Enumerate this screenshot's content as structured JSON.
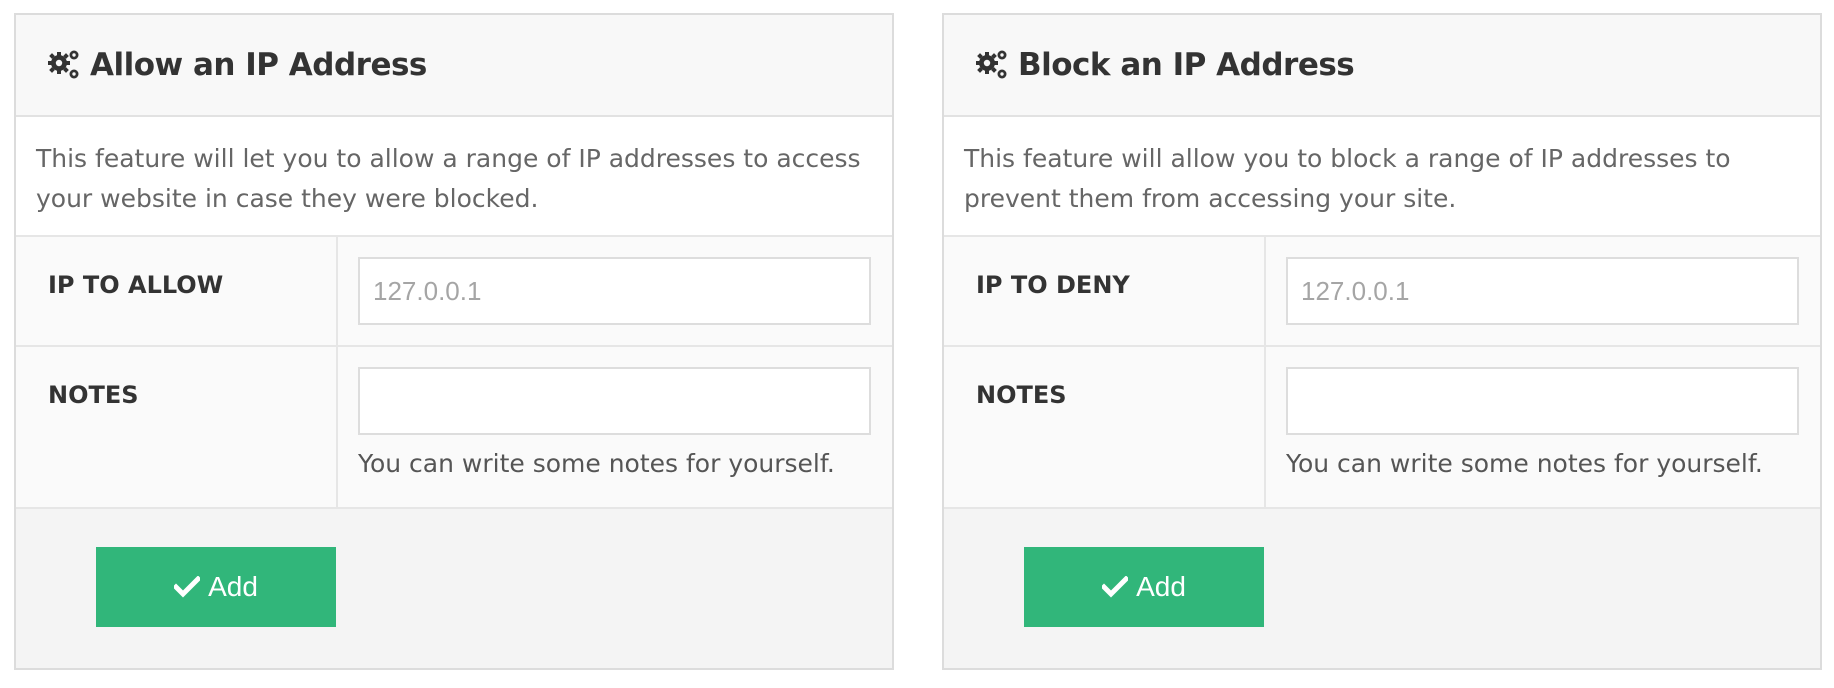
{
  "allow_panel": {
    "title": "Allow an IP Address",
    "icon": "gears-icon",
    "description": "This feature will let you to allow a range of IP addresses to access your website in case they were blocked.",
    "ip_label": "IP TO ALLOW",
    "ip_placeholder": "127.0.0.1",
    "ip_value": "",
    "notes_label": "NOTES",
    "notes_value": "",
    "notes_help": "You can write some notes for yourself.",
    "add_label": "Add",
    "add_icon": "check-icon"
  },
  "block_panel": {
    "title": "Block an IP Address",
    "icon": "gears-icon",
    "description": "This feature will allow you to block a range of IP addresses to prevent them from accessing your site.",
    "ip_label": "IP TO DENY",
    "ip_placeholder": "127.0.0.1",
    "ip_value": "",
    "notes_label": "NOTES",
    "notes_value": "",
    "notes_help": "You can write some notes for yourself.",
    "add_label": "Add",
    "add_icon": "check-icon"
  },
  "colors": {
    "button": "#31b67a",
    "header_bg": "#f8f8f8",
    "footer_bg": "#f4f4f4",
    "border": "#dcdcdc"
  }
}
